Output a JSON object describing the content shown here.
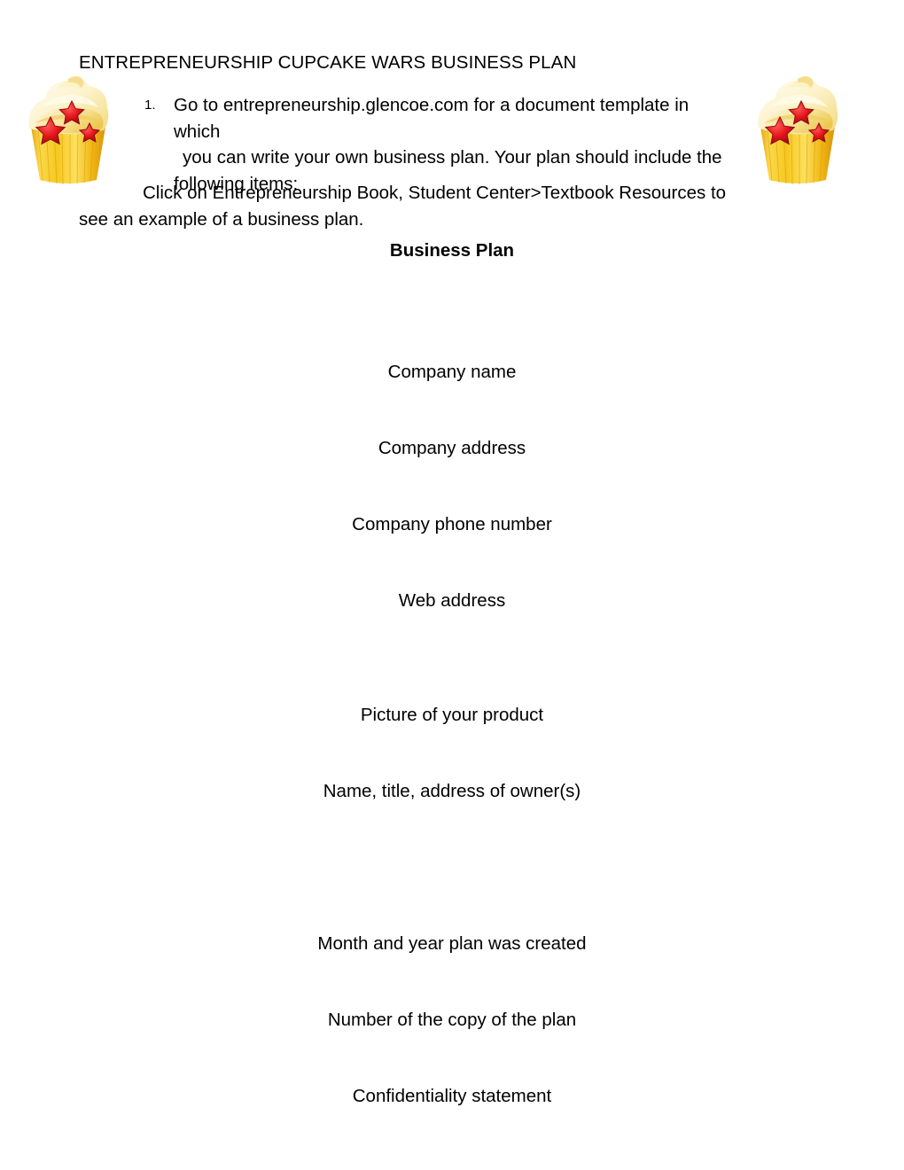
{
  "document": {
    "title": "ENTREPRENEURSHIP CUPCAKE WARS BUSINESS PLAN",
    "numbered_item": {
      "marker": "1.",
      "line1": "Go to entrepreneurship.glencoe.com for a document template in which",
      "line2": "you can write your own business plan. Your plan should include the",
      "line3": "following items:"
    },
    "body_paragraph": "Click on Entrepreneurship Book, Student Center>Textbook Resources to see an example of a business plan.",
    "plan_heading": "Business Plan",
    "plan_items": [
      {
        "text": ""
      },
      {
        "text": "Company name"
      },
      {
        "text": ""
      },
      {
        "text": "Company address"
      },
      {
        "text": ""
      },
      {
        "text": "Company phone number"
      },
      {
        "text": ""
      },
      {
        "text": "Web address"
      },
      {
        "text": ""
      },
      {
        "text": ""
      },
      {
        "text": "Picture of your product"
      },
      {
        "text": ""
      },
      {
        "text": "Name, title, address of owner(s)"
      },
      {
        "text": ""
      },
      {
        "text": ""
      },
      {
        "text": ""
      },
      {
        "text": "Month and year plan was created"
      },
      {
        "text": ""
      },
      {
        "text": "Number of the copy of the plan"
      },
      {
        "text": ""
      },
      {
        "text": "Confidentiality statement"
      }
    ]
  },
  "images": {
    "cupcake_left": "cupcake-clipart",
    "cupcake_right": "cupcake-clipart"
  },
  "colors": {
    "page_background": "#ffffff",
    "text": "#000000",
    "frosting_light": "#fdf6d8",
    "frosting_mid": "#f7e08a",
    "frosting_shadow": "#f0cf5e",
    "wrapper_light": "#fbd94b",
    "wrapper_mid": "#f2c01a",
    "wrapper_dark": "#e09a0c",
    "star_red": "#e5141d",
    "star_dark": "#9b0c12"
  }
}
